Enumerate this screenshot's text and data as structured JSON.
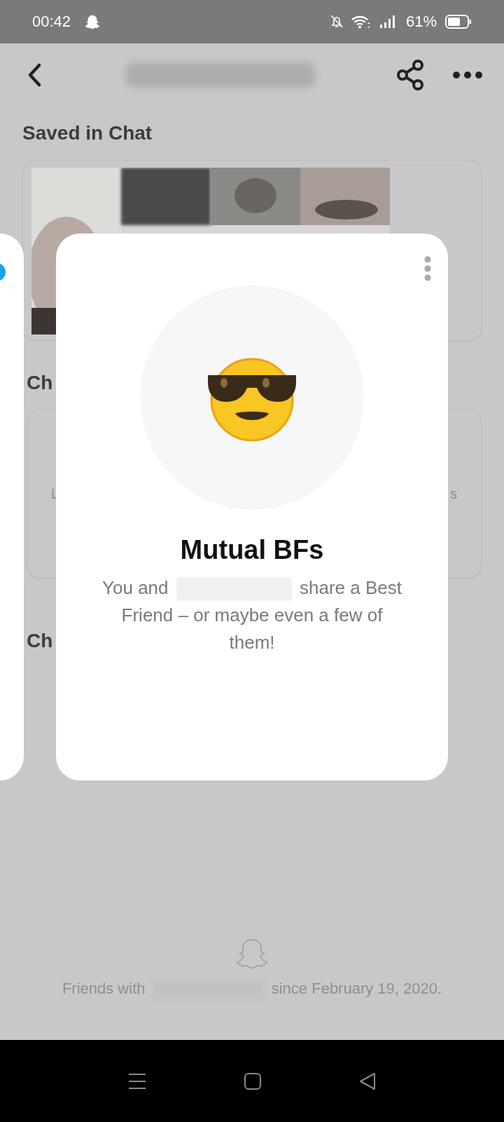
{
  "status_bar": {
    "time": "00:42",
    "battery": "61%"
  },
  "sections": [
    {
      "title": "Saved in Chat",
      "kind": "media"
    },
    {
      "title": "Ch",
      "kind": "text",
      "left": "L",
      "right": "s"
    },
    {
      "title": "Ch",
      "kind": "heading"
    }
  ],
  "popup": {
    "title": "Mutual BFs",
    "text_before": "You and",
    "text_after": "share a Best Friend – or maybe even a few of them!"
  },
  "footer": {
    "text_before": "Friends with",
    "text_after": "since February 19, 2020."
  }
}
